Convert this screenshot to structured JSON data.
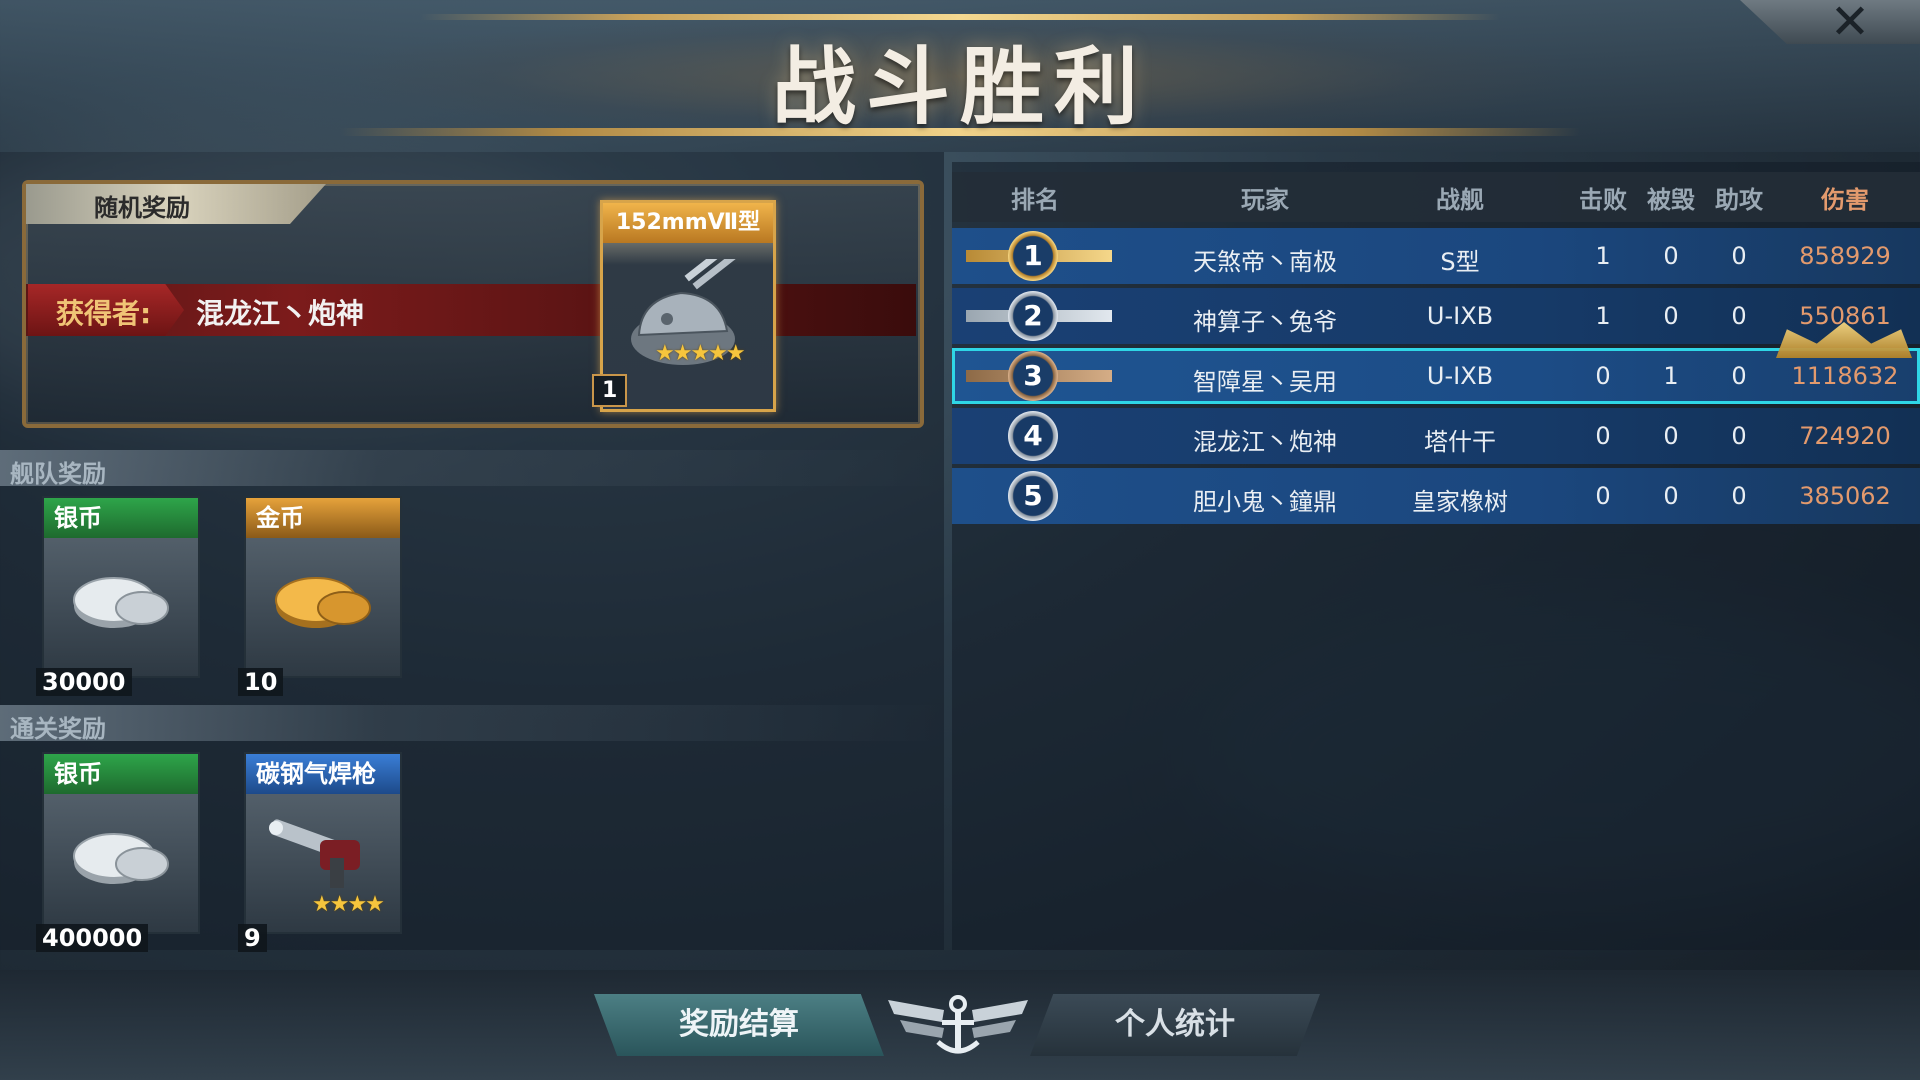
{
  "title": "战斗胜利",
  "close_glyph": "✕",
  "random_reward": {
    "section_label": "随机奖励",
    "winner_label": "获得者:",
    "winner_name": "混龙江丶炮神",
    "item": {
      "name": "152mmⅦ型",
      "quantity": "1",
      "stars": 5,
      "icon": "naval-gun-turret-icon"
    }
  },
  "fleet_reward": {
    "section_label": "舰队奖励",
    "items": [
      {
        "name": "银币",
        "quantity": "30000",
        "icon": "silver-coins-icon",
        "header_color": "#2c8a3a"
      },
      {
        "name": "金币",
        "quantity": "10",
        "icon": "gold-coins-icon",
        "header_color": "#d08a2a"
      }
    ]
  },
  "clear_reward": {
    "section_label": "通关奖励",
    "items": [
      {
        "name": "银币",
        "quantity": "400000",
        "icon": "silver-coins-icon",
        "header_color": "#2c8a3a"
      },
      {
        "name": "碳钢气焊枪",
        "quantity": "9",
        "icon": "welding-torch-icon",
        "stars": 4,
        "header_color": "#2a67b8"
      }
    ]
  },
  "table": {
    "headers": [
      "排名",
      "玩家",
      "战舰",
      "击败",
      "被毁",
      "助攻",
      "伤害"
    ],
    "rows": [
      {
        "rank": "1",
        "player": "天煞帝丶南极",
        "ship": "S型",
        "kills": "1",
        "deaths": "0",
        "assists": "0",
        "damage": "858929"
      },
      {
        "rank": "2",
        "player": "神算子丶兔爷",
        "ship": "U-IXB",
        "kills": "1",
        "deaths": "0",
        "assists": "0",
        "damage": "550861"
      },
      {
        "rank": "3",
        "player": "智障星丶吴用",
        "ship": "U-IXB",
        "kills": "0",
        "deaths": "1",
        "assists": "0",
        "damage": "1118632"
      },
      {
        "rank": "4",
        "player": "混龙江丶炮神",
        "ship": "塔什干",
        "kills": "0",
        "deaths": "0",
        "assists": "0",
        "damage": "724920"
      },
      {
        "rank": "5",
        "player": "胆小鬼丶鐘鼎",
        "ship": "皇家橡树",
        "kills": "0",
        "deaths": "0",
        "assists": "0",
        "damage": "385062"
      }
    ],
    "highlighted_row": 3,
    "top_damage_row": 3
  },
  "bottom": {
    "left_button": "奖励结算",
    "right_button": "个人统计",
    "emblem_icon": "anchor-wings-emblem-icon"
  },
  "colors": {
    "accent_gold": "#d7a44a",
    "damage": "#e39a6d",
    "highlight": "#2fd6e6"
  }
}
